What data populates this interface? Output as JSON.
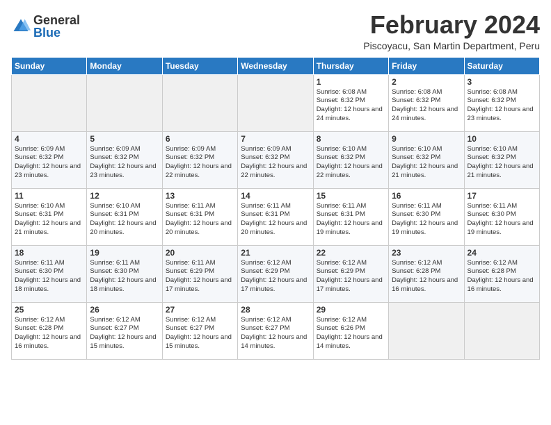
{
  "logo": {
    "text_general": "General",
    "text_blue": "Blue"
  },
  "header": {
    "month_year": "February 2024",
    "subtitle": "Piscoyacu, San Martin Department, Peru"
  },
  "days_of_week": [
    "Sunday",
    "Monday",
    "Tuesday",
    "Wednesday",
    "Thursday",
    "Friday",
    "Saturday"
  ],
  "weeks": [
    [
      {
        "day": "",
        "info": ""
      },
      {
        "day": "",
        "info": ""
      },
      {
        "day": "",
        "info": ""
      },
      {
        "day": "",
        "info": ""
      },
      {
        "day": "1",
        "info": "Sunrise: 6:08 AM\nSunset: 6:32 PM\nDaylight: 12 hours and 24 minutes."
      },
      {
        "day": "2",
        "info": "Sunrise: 6:08 AM\nSunset: 6:32 PM\nDaylight: 12 hours and 24 minutes."
      },
      {
        "day": "3",
        "info": "Sunrise: 6:08 AM\nSunset: 6:32 PM\nDaylight: 12 hours and 23 minutes."
      }
    ],
    [
      {
        "day": "4",
        "info": "Sunrise: 6:09 AM\nSunset: 6:32 PM\nDaylight: 12 hours and 23 minutes."
      },
      {
        "day": "5",
        "info": "Sunrise: 6:09 AM\nSunset: 6:32 PM\nDaylight: 12 hours and 23 minutes."
      },
      {
        "day": "6",
        "info": "Sunrise: 6:09 AM\nSunset: 6:32 PM\nDaylight: 12 hours and 22 minutes."
      },
      {
        "day": "7",
        "info": "Sunrise: 6:09 AM\nSunset: 6:32 PM\nDaylight: 12 hours and 22 minutes."
      },
      {
        "day": "8",
        "info": "Sunrise: 6:10 AM\nSunset: 6:32 PM\nDaylight: 12 hours and 22 minutes."
      },
      {
        "day": "9",
        "info": "Sunrise: 6:10 AM\nSunset: 6:32 PM\nDaylight: 12 hours and 21 minutes."
      },
      {
        "day": "10",
        "info": "Sunrise: 6:10 AM\nSunset: 6:32 PM\nDaylight: 12 hours and 21 minutes."
      }
    ],
    [
      {
        "day": "11",
        "info": "Sunrise: 6:10 AM\nSunset: 6:31 PM\nDaylight: 12 hours and 21 minutes."
      },
      {
        "day": "12",
        "info": "Sunrise: 6:10 AM\nSunset: 6:31 PM\nDaylight: 12 hours and 20 minutes."
      },
      {
        "day": "13",
        "info": "Sunrise: 6:11 AM\nSunset: 6:31 PM\nDaylight: 12 hours and 20 minutes."
      },
      {
        "day": "14",
        "info": "Sunrise: 6:11 AM\nSunset: 6:31 PM\nDaylight: 12 hours and 20 minutes."
      },
      {
        "day": "15",
        "info": "Sunrise: 6:11 AM\nSunset: 6:31 PM\nDaylight: 12 hours and 19 minutes."
      },
      {
        "day": "16",
        "info": "Sunrise: 6:11 AM\nSunset: 6:30 PM\nDaylight: 12 hours and 19 minutes."
      },
      {
        "day": "17",
        "info": "Sunrise: 6:11 AM\nSunset: 6:30 PM\nDaylight: 12 hours and 19 minutes."
      }
    ],
    [
      {
        "day": "18",
        "info": "Sunrise: 6:11 AM\nSunset: 6:30 PM\nDaylight: 12 hours and 18 minutes."
      },
      {
        "day": "19",
        "info": "Sunrise: 6:11 AM\nSunset: 6:30 PM\nDaylight: 12 hours and 18 minutes."
      },
      {
        "day": "20",
        "info": "Sunrise: 6:11 AM\nSunset: 6:29 PM\nDaylight: 12 hours and 17 minutes."
      },
      {
        "day": "21",
        "info": "Sunrise: 6:12 AM\nSunset: 6:29 PM\nDaylight: 12 hours and 17 minutes."
      },
      {
        "day": "22",
        "info": "Sunrise: 6:12 AM\nSunset: 6:29 PM\nDaylight: 12 hours and 17 minutes."
      },
      {
        "day": "23",
        "info": "Sunrise: 6:12 AM\nSunset: 6:28 PM\nDaylight: 12 hours and 16 minutes."
      },
      {
        "day": "24",
        "info": "Sunrise: 6:12 AM\nSunset: 6:28 PM\nDaylight: 12 hours and 16 minutes."
      }
    ],
    [
      {
        "day": "25",
        "info": "Sunrise: 6:12 AM\nSunset: 6:28 PM\nDaylight: 12 hours and 16 minutes."
      },
      {
        "day": "26",
        "info": "Sunrise: 6:12 AM\nSunset: 6:27 PM\nDaylight: 12 hours and 15 minutes."
      },
      {
        "day": "27",
        "info": "Sunrise: 6:12 AM\nSunset: 6:27 PM\nDaylight: 12 hours and 15 minutes."
      },
      {
        "day": "28",
        "info": "Sunrise: 6:12 AM\nSunset: 6:27 PM\nDaylight: 12 hours and 14 minutes."
      },
      {
        "day": "29",
        "info": "Sunrise: 6:12 AM\nSunset: 6:26 PM\nDaylight: 12 hours and 14 minutes."
      },
      {
        "day": "",
        "info": ""
      },
      {
        "day": "",
        "info": ""
      }
    ]
  ]
}
